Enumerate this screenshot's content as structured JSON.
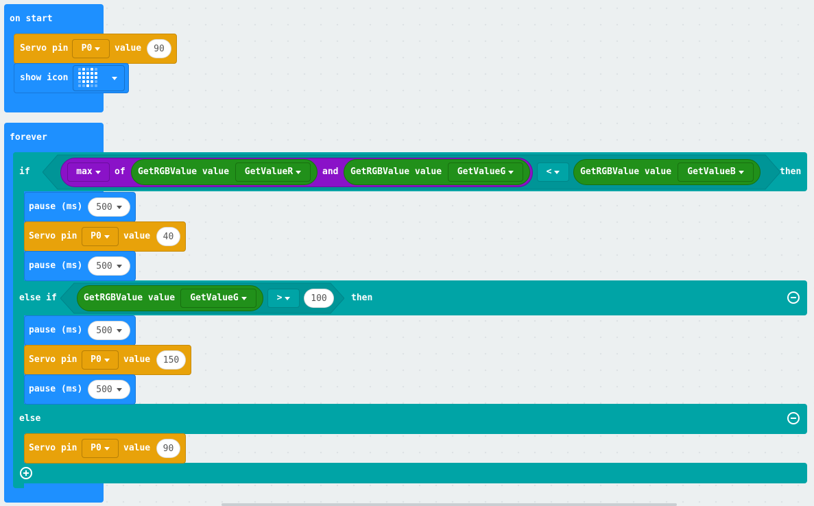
{
  "on_start": {
    "hat_label": "on start",
    "servo": {
      "label": "Servo pin",
      "pin": "P0",
      "value_label": "value",
      "value": "90"
    },
    "show_icon": {
      "label": "show icon"
    }
  },
  "forever": {
    "hat_label": "forever",
    "if_block": {
      "if_label": "if",
      "max_label": "max",
      "of_label": "of",
      "getrgb_label": "GetRGBValue value",
      "r_option": "GetValueR",
      "and_label": "and",
      "g_option": "GetValueG",
      "lt_op": "<",
      "b_option": "GetValueB",
      "then_label": "then",
      "body": {
        "pause1": {
          "label": "pause (ms)",
          "value": "500"
        },
        "servo": {
          "label": "Servo pin",
          "pin": "P0",
          "value_label": "value",
          "value": "40"
        },
        "pause2": {
          "label": "pause (ms)",
          "value": "500"
        }
      }
    },
    "else_if_block": {
      "label": "else if",
      "getrgb_label": "GetRGBValue value",
      "g_option": "GetValueG",
      "gt_op": ">",
      "threshold": "100",
      "then_label": "then",
      "body": {
        "pause1": {
          "label": "pause (ms)",
          "value": "500"
        },
        "servo": {
          "label": "Servo pin",
          "pin": "P0",
          "value_label": "value",
          "value": "150"
        },
        "pause2": {
          "label": "pause (ms)",
          "value": "500"
        }
      }
    },
    "else_block": {
      "label": "else",
      "body": {
        "servo": {
          "label": "Servo pin",
          "pin": "P0",
          "value_label": "value",
          "value": "90"
        }
      }
    }
  },
  "colors": {
    "basic_blue": "#1e90ff",
    "servo_orange": "#e8a20a",
    "logic_teal": "#00a4a6",
    "extension_green": "#21901a",
    "math_purple": "#8a12c8",
    "workspace_bg": "#ecf0f1"
  },
  "icons": {
    "show_icon_picker": "heart-icon",
    "dropdown": "caret-down-icon",
    "remove_branch": "minus-circle-icon",
    "add_branch": "plus-circle-icon"
  }
}
